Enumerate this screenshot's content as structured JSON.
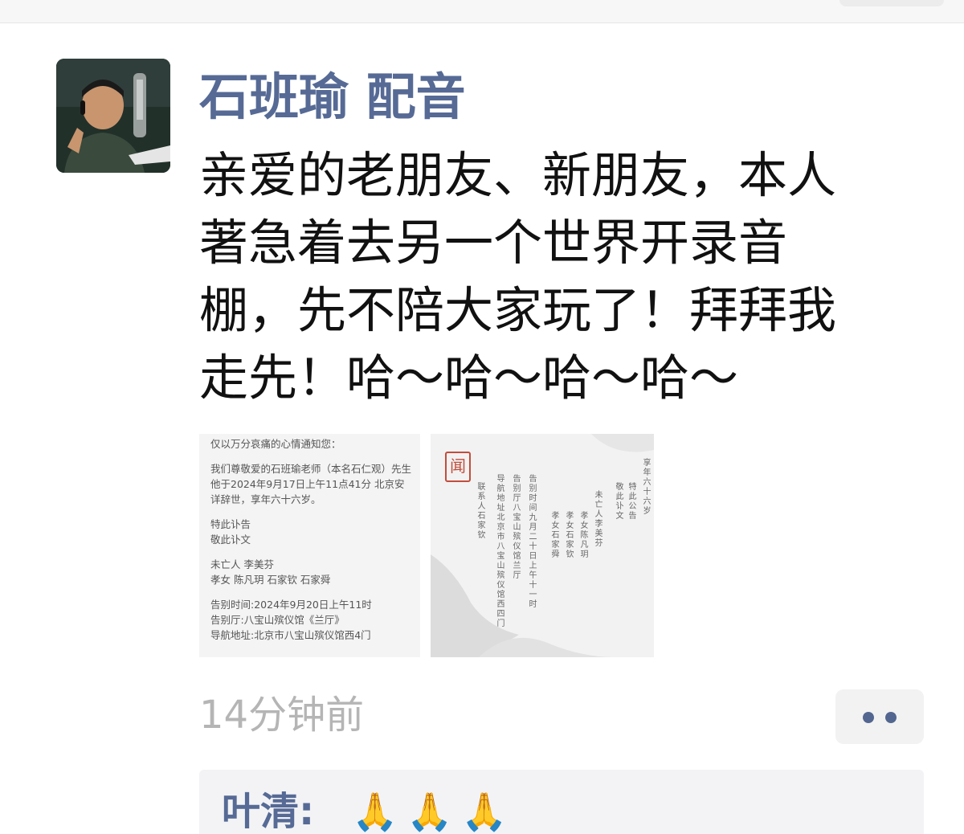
{
  "post": {
    "author": "石班瑜 配音",
    "content_lines": [
      "亲爱的老朋友、新朋友，本人",
      "著急着去另一个世界开录音",
      "棚，先不陪大家玩了！拜拜我",
      "走先！哈～哈～哈～哈～"
    ],
    "timestamp": "14分钟前",
    "avatar_icon": "user-avatar-photo",
    "more_icon": "more-dots-icon",
    "accent_color": "#566a95"
  },
  "photos": {
    "notice_lines": [
      "仅以万分哀痛的心情通知您：",
      "",
      "我们尊敬爱的石班瑜老师（本名石仁观）先生",
      "他于2024年9月17日上午11点41分 北京安",
      "详辞世，享年六十六岁。",
      "",
      "特此讣告",
      "敬此讣文",
      "",
      "未亡人 李美芬",
      "孝女 陈凡玥 石家钦 石家舜",
      "",
      "告别时间:2024年9月20日上午11时",
      "告别厅:八宝山殡仪馆《兰厅》",
      "导航地址:北京市八宝山殡仪馆西4门"
    ],
    "seal_char": "闻",
    "vertical_columns": [
      "享年六十六岁",
      "特此公告",
      "敬此讣文",
      "未亡人李美芬",
      "孝女陈凡玥",
      "孝女石家钦",
      "孝女石家舜",
      "告别时间九月二十日上午十一时",
      "告别厅八宝山殡仪馆兰厅",
      "导航地址北京市八宝山殡仪馆西四门",
      "联系人石家钦"
    ]
  },
  "comment": {
    "author": "叶清:",
    "emoji": [
      "🙏",
      "🙏",
      "🙏"
    ]
  }
}
